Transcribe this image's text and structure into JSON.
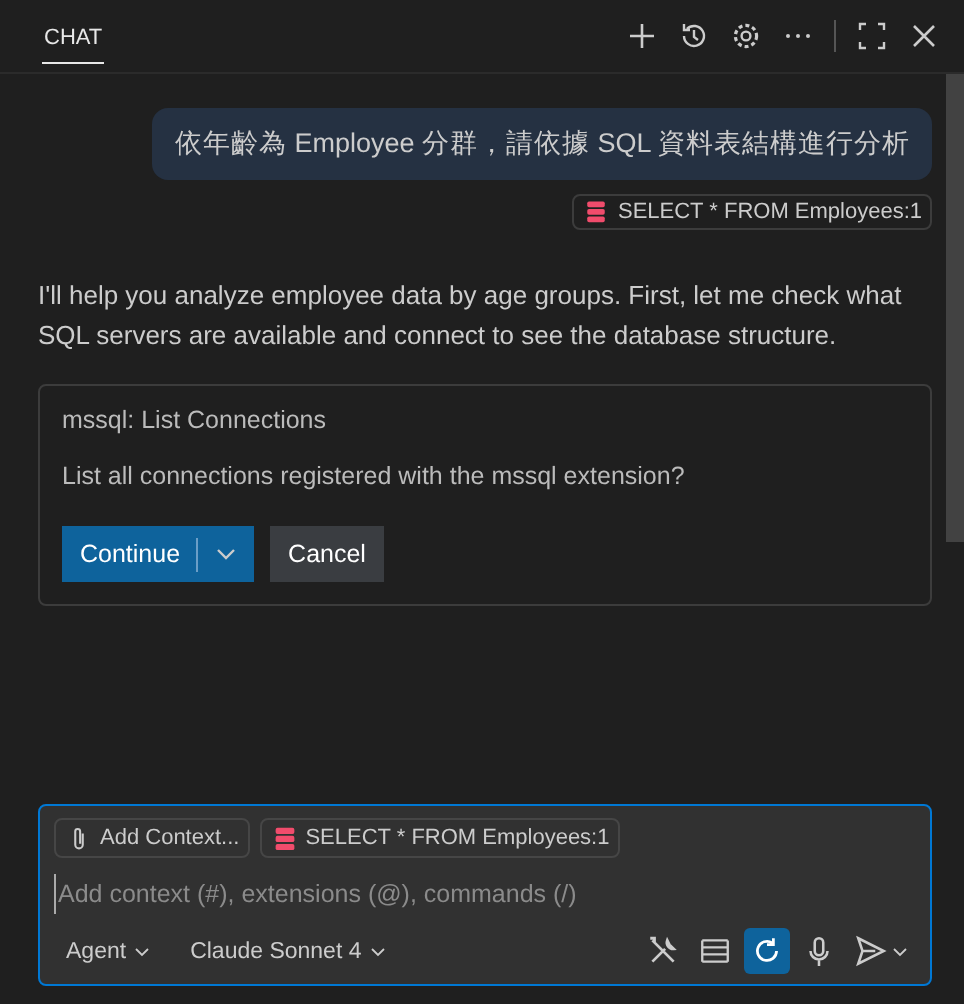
{
  "header": {
    "tabs": [
      {
        "label": "CHAT",
        "selected": true
      }
    ],
    "actions": [
      {
        "kind": "new"
      },
      {
        "kind": "history"
      },
      {
        "kind": "settings"
      },
      {
        "kind": "more"
      },
      {
        "kind": "divider"
      },
      {
        "kind": "maximize"
      },
      {
        "kind": "close"
      }
    ]
  },
  "user_message": {
    "text": "依年齡為 Employee 分群，請依據 SQL 資料表結構進行分析",
    "reference": "SELECT * FROM Employees:1"
  },
  "response": {
    "text": "I'll help you analyze employee data by age groups. First, let me check what SQL servers are available and connect to see the database structure."
  },
  "tool_card": {
    "title": "mssql: List Connections",
    "question": "List all connections registered with the mssql extension?",
    "buttons": [
      {
        "label": "Continue",
        "kind": "primary"
      },
      {
        "label": "Cancel",
        "kind": "secondary"
      }
    ]
  },
  "input": {
    "attachments": [
      {
        "kind": "add",
        "label": "Add Context..."
      },
      {
        "kind": "database",
        "label": "SELECT * FROM Employees:1"
      }
    ],
    "placeholder": "Add context (#), extensions (@), commands (/)",
    "mode": "Agent",
    "model": "Claude Sonnet 4",
    "tools": [
      {
        "kind": "tools",
        "on": false
      },
      {
        "kind": "list",
        "on": false
      },
      {
        "kind": "refresh",
        "on": true
      },
      {
        "kind": "mic",
        "on": false
      },
      {
        "kind": "send",
        "on": false
      }
    ]
  }
}
